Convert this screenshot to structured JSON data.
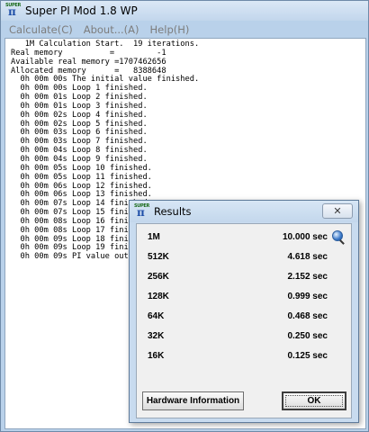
{
  "main_window": {
    "title": "Super PI Mod 1.8 WP",
    "icon": "super-pi-icon",
    "icon_text": "SUPER",
    "icon_glyph": "π",
    "menu": [
      "Calculate(C)",
      "About...(A)",
      "Help(H)"
    ]
  },
  "console_lines": [
    "   1M Calculation Start.  19 iterations.",
    "Real memory          =         -1",
    "Available real memory =1707462656",
    "Allocated memory      =   8388648",
    "  0h 00m 00s The initial value finished.",
    "  0h 00m 00s Loop 1 finished.",
    "  0h 00m 01s Loop 2 finished.",
    "  0h 00m 01s Loop 3 finished.",
    "  0h 00m 02s Loop 4 finished.",
    "  0h 00m 02s Loop 5 finished.",
    "  0h 00m 03s Loop 6 finished.",
    "  0h 00m 03s Loop 7 finished.",
    "  0h 00m 04s Loop 8 finished.",
    "  0h 00m 04s Loop 9 finished.",
    "  0h 00m 05s Loop 10 finished.",
    "  0h 00m 05s Loop 11 finished.",
    "  0h 00m 06s Loop 12 finished.",
    "  0h 00m 06s Loop 13 finished.",
    "  0h 00m 07s Loop 14 finished.",
    "  0h 00m 07s Loop 15 finished.",
    "  0h 00m 08s Loop 16 finished.",
    "  0h 00m 08s Loop 17 finished.",
    "  0h 00m 09s Loop 18 finished.",
    "  0h 00m 09s Loop 19 finished.",
    "  0h 00m 09s PI value output -> pi_data.txt"
  ],
  "results_dialog": {
    "title": "Results",
    "close_label": "✕",
    "rows": [
      {
        "label": "1M",
        "value": "10.000 sec"
      },
      {
        "label": "512K",
        "value": "4.618 sec"
      },
      {
        "label": "256K",
        "value": "2.152 sec"
      },
      {
        "label": "128K",
        "value": "0.999 sec"
      },
      {
        "label": "64K",
        "value": "0.468 sec"
      },
      {
        "label": "32K",
        "value": "0.250 sec"
      },
      {
        "label": "16K",
        "value": "0.125 sec"
      }
    ],
    "globe_icon": "globe-search-icon",
    "hardware_button": "Hardware Information",
    "ok_button": "OK"
  }
}
